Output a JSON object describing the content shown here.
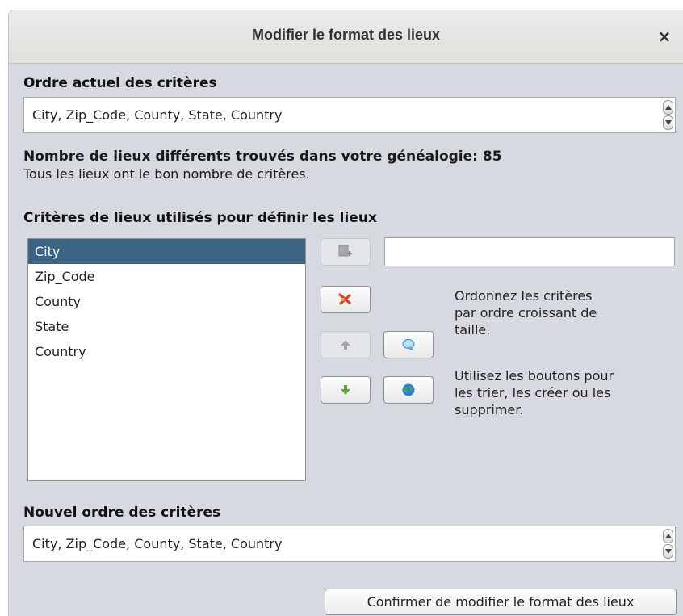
{
  "window": {
    "title": "Modifier le format des lieux",
    "close_label": "×"
  },
  "current_order": {
    "label": "Ordre actuel des critères",
    "value": "City, Zip_Code, County, State, Country"
  },
  "stats": {
    "count_text": "Nombre de lieux différents trouvés dans votre généalogie: 85",
    "status_text": "Tous les lieux ont le bon nombre de critères."
  },
  "criteria": {
    "label": "Critères de lieux utilisés pour définir les lieux",
    "items": [
      "City",
      "Zip_Code",
      "County",
      "State",
      "Country"
    ],
    "selected": "City",
    "new_criterion_value": ""
  },
  "help": {
    "paragraph1": [
      "Ordonnez les critères",
      "par ordre croissant de",
      "taille."
    ],
    "paragraph2": [
      "Utilisez les boutons pour",
      "les trier, les créer ou les",
      "supprimer."
    ]
  },
  "buttons": {
    "add_icon": "add-criterion-icon",
    "delete_icon": "delete-criterion-icon",
    "up_icon": "arrow-up-icon",
    "down_icon": "arrow-down-icon",
    "bubble_icon": "speech-bubble-icon",
    "globe_icon": "globe-icon"
  },
  "new_order": {
    "label": "Nouvel ordre des critères",
    "value": "City, Zip_Code, County, State, Country"
  },
  "confirm_label": "Confirmer de modifier le format des lieux",
  "colors": {
    "dialog_bg": "#d6d9df",
    "selection": "#3c6583",
    "delete_red": "#e0431f",
    "arrow_green": "#5aa530"
  }
}
